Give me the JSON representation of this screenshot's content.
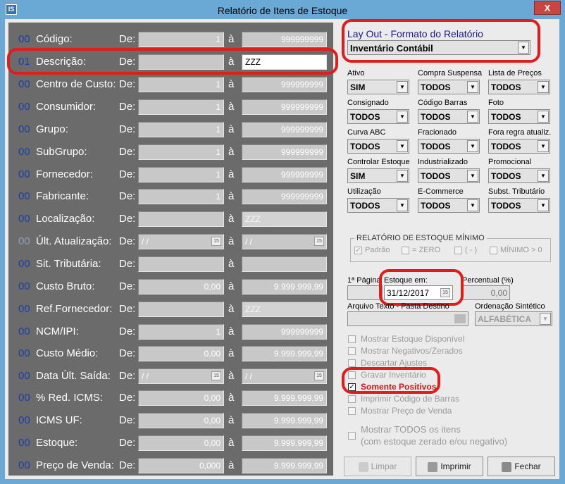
{
  "window": {
    "title": "Relatório de Itens de Estoque",
    "icon_text": "IS",
    "close": "X"
  },
  "filters": {
    "de_label": "De:",
    "a_label": "à",
    "rows": [
      {
        "num": "00",
        "label": "Código:",
        "from": "1",
        "to": "999999999"
      },
      {
        "num": "01",
        "label": "Descrição:",
        "from": "",
        "to": "ZZZ"
      },
      {
        "num": "00",
        "label": "Centro de Custo:",
        "from": "1",
        "to": "999999999"
      },
      {
        "num": "00",
        "label": "Consumidor:",
        "from": "1",
        "to": "999999999"
      },
      {
        "num": "00",
        "label": "Grupo:",
        "from": "1",
        "to": "999999999"
      },
      {
        "num": "00",
        "label": "SubGrupo:",
        "from": "1",
        "to": "999999999"
      },
      {
        "num": "00",
        "label": "Fornecedor:",
        "from": "1",
        "to": "999999999"
      },
      {
        "num": "00",
        "label": "Fabricante:",
        "from": "1",
        "to": "999999999"
      },
      {
        "num": "00",
        "label": "Localização:",
        "from": "",
        "to": "ZZZ"
      },
      {
        "num": "00",
        "label": "Últ. Atualização:",
        "from": "/ /",
        "to": "/ /"
      },
      {
        "num": "00",
        "label": "Sit. Tributária:",
        "from": "",
        "to": ""
      },
      {
        "num": "00",
        "label": "Custo Bruto:",
        "from": "0,00",
        "to": "9.999.999,99"
      },
      {
        "num": "00",
        "label": "Ref.Fornecedor:",
        "from": "",
        "to": "ZZZ"
      },
      {
        "num": "00",
        "label": "NCM/IPI:",
        "from": "1",
        "to": "999999999"
      },
      {
        "num": "00",
        "label": "Custo Médio:",
        "from": "0,00",
        "to": "9.999.999,99"
      },
      {
        "num": "00",
        "label": "Data Últ. Saída:",
        "from": "/ /",
        "to": "/ /"
      },
      {
        "num": "00",
        "label": "% Red. ICMS:",
        "from": "0,00",
        "to": "9.999.999,99"
      },
      {
        "num": "00",
        "label": "ICMS UF:",
        "from": "0,00",
        "to": "9.999.999,99"
      },
      {
        "num": "00",
        "label": "Estoque:",
        "from": "0,00",
        "to": "9.999.999,99"
      },
      {
        "num": "00",
        "label": "Preço de Venda:",
        "from": "0,000",
        "to": "9.999.999,99"
      }
    ]
  },
  "layout_section": {
    "title": "Lay Out - Formato do Relatório",
    "value": "Inventário Contábil"
  },
  "options": [
    {
      "label": "Ativo",
      "value": "SIM"
    },
    {
      "label": "Compra Suspensa",
      "value": "TODOS"
    },
    {
      "label": "Lista de Preços",
      "value": "TODOS"
    },
    {
      "label": "Consignado",
      "value": "TODOS"
    },
    {
      "label": "Código Barras",
      "value": "TODOS"
    },
    {
      "label": "Foto",
      "value": "TODOS"
    },
    {
      "label": "Curva ABC",
      "value": "TODOS"
    },
    {
      "label": "Fracionado",
      "value": "TODOS"
    },
    {
      "label": "Fora regra atualiz.",
      "value": "TODOS"
    },
    {
      "label": "Controlar Estoque",
      "value": "SIM"
    },
    {
      "label": "Industrializado",
      "value": "TODOS"
    },
    {
      "label": "Promocional",
      "value": "TODOS"
    },
    {
      "label": "Utilização",
      "value": "TODOS"
    },
    {
      "label": "E-Commerce",
      "value": "TODOS"
    },
    {
      "label": "Subst. Tributário",
      "value": "TODOS"
    }
  ],
  "estoque_minimo": {
    "title": "RELATÓRIO DE ESTOQUE MÍNIMO",
    "padrao": "Padrão",
    "zero": "= ZERO",
    "menos": "( - )",
    "minimo": "MÍNIMO > 0"
  },
  "pagina": {
    "label": "1ª Página",
    "estoque_label": "Estoque em:",
    "estoque_value": "31/12/2017",
    "percentual_label": "Percentual (%)",
    "percentual_value": "0,00"
  },
  "arquivo": {
    "label": "Arquivo Texto - Pasta Destino",
    "ordenacao_label": "Ordenação Sintético",
    "ordenacao_value": "ALFABÉTICA"
  },
  "checks": {
    "disponivel": "Mostrar Estoque Disponível",
    "negativos": "Mostrar Negativos/Zerados",
    "ajustes": "Descartar Ajustes",
    "gravar": "Gravar Inventário",
    "positivos": "Somente Positivos",
    "barras": "Imprimir Código de Barras",
    "preco": "Mostrar Preço de Venda",
    "todos_1": "Mostrar TODOS os itens",
    "todos_2": "(com estoque zerado e/ou negativo)"
  },
  "buttons": {
    "limpar": "Limpar",
    "imprimir": "Imprimir",
    "fechar": "Fechar"
  },
  "colors": {
    "highlight": "#e21b1b",
    "panel": "#6b6b6b",
    "accent": "#1b3fa6"
  }
}
